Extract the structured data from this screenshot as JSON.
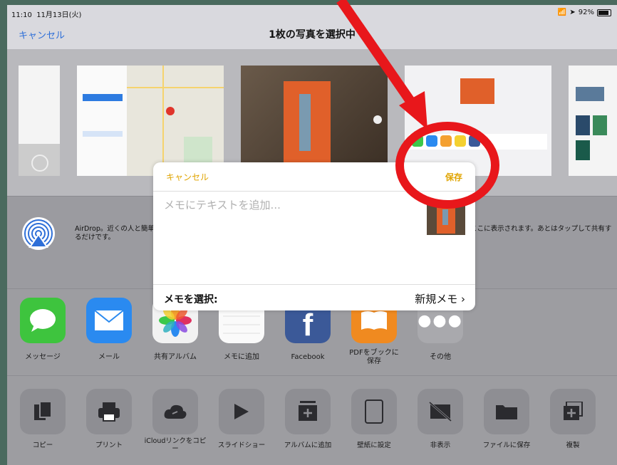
{
  "status": {
    "time": "11:10",
    "date": "11月13日(火)",
    "battery": "92%"
  },
  "nav": {
    "cancel": "キャンセル",
    "title": "1枚の写真を選択中"
  },
  "airdrop": {
    "text": "AirDrop。近くの人と簡単に共有できます。近くにいる人がコントロールセンターからAirDropをオンにすると、近くの人の名前がここに表示されます。あとはタップして共有するだけです。"
  },
  "apps": [
    {
      "label": "メッセージ"
    },
    {
      "label": "メール"
    },
    {
      "label": "共有アルバム"
    },
    {
      "label": "メモに追加"
    },
    {
      "label": "Facebook"
    },
    {
      "label": "PDFをブックに保存"
    },
    {
      "label": "その他"
    }
  ],
  "actions": [
    {
      "label": "コピー"
    },
    {
      "label": "プリント"
    },
    {
      "label": "iCloudリンクをコピー"
    },
    {
      "label": "スライドショー"
    },
    {
      "label": "アルバムに追加"
    },
    {
      "label": "壁紙に設定"
    },
    {
      "label": "非表示"
    },
    {
      "label": "ファイルに保存"
    },
    {
      "label": "複製"
    }
  ],
  "dialog": {
    "cancel": "キャンセル",
    "save": "保存",
    "placeholder": "メモにテキストを追加...",
    "select_label": "メモを選択:",
    "selected_note": "新規メモ ›"
  },
  "colors": {
    "accent_blue": "#2e6fd8",
    "accent_yellow": "#e0a400",
    "annotation_red": "#e8171b"
  },
  "icons": {
    "status": [
      "wifi-icon",
      "location-icon",
      "battery-icon"
    ]
  }
}
